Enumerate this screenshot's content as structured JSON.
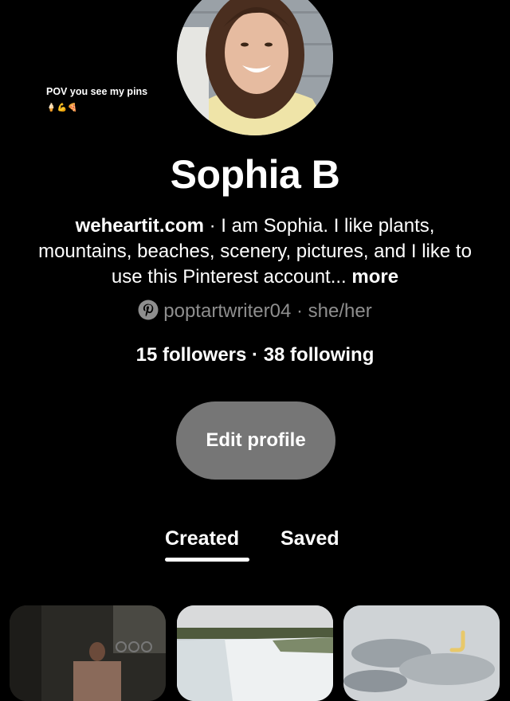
{
  "caption": {
    "text": "POV you see my pins",
    "emoji": "🍦💪🍕"
  },
  "profile": {
    "name": "Sophia B",
    "website": "weheartit.com",
    "separator": " · ",
    "bio": "I am Sophia. I like plants, mountains, beaches, scenery, pictures, and I like to use this Pinterest account...",
    "more": "more",
    "handle": "poptartwriter04",
    "pronouns": "she/her",
    "followers": "15 followers",
    "following": "38 following",
    "edit_button": "Edit profile"
  },
  "tabs": [
    {
      "label": "Created",
      "active": true
    },
    {
      "label": "Saved",
      "active": false
    }
  ],
  "icons": {
    "handle_logo": "pinterest-logo-icon"
  },
  "colors": {
    "background": "#000000",
    "muted_text": "#8e8e8e",
    "button": "#767676"
  }
}
